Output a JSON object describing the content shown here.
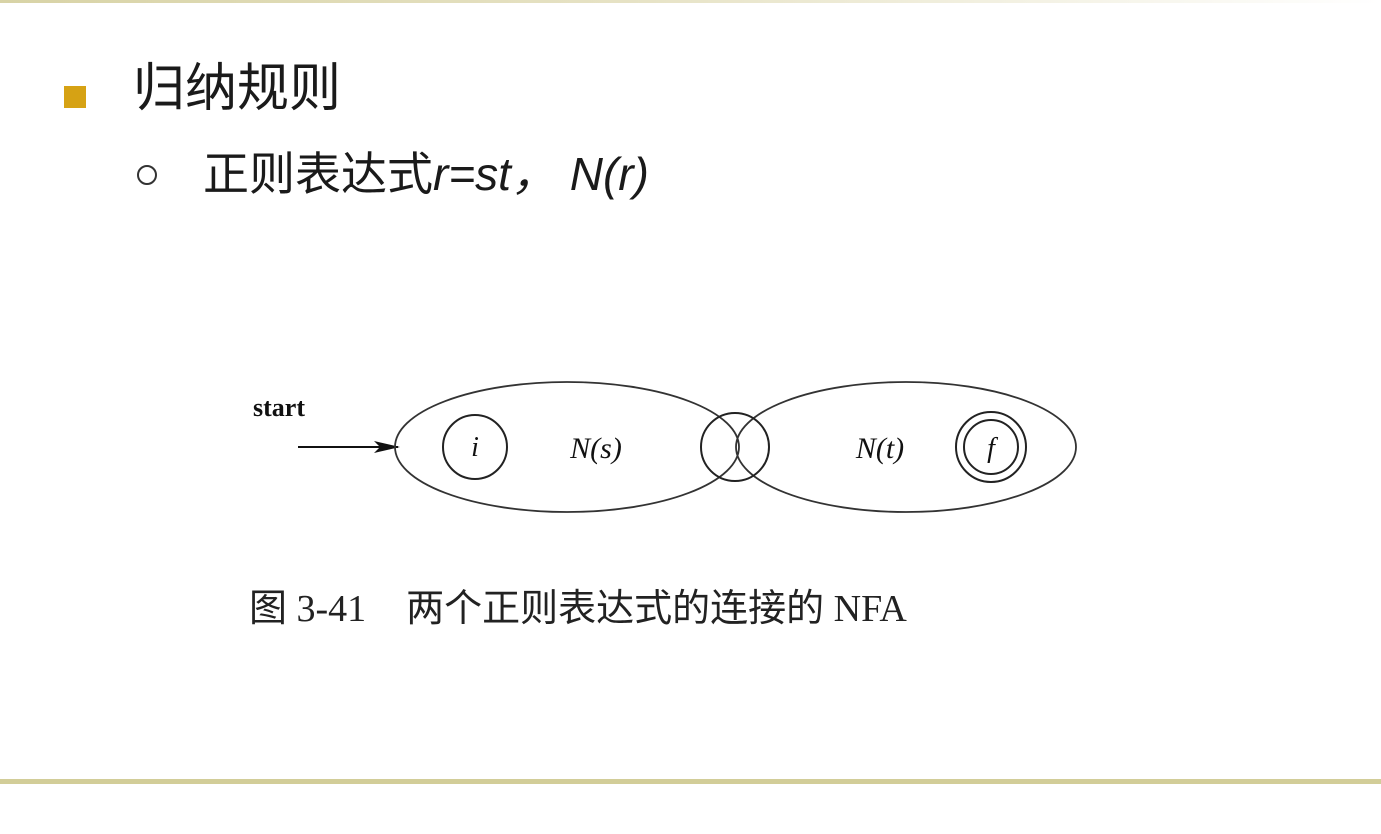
{
  "slide": {
    "heading": "归纳规则",
    "subline_prefix": "正则表达式",
    "subline_expr": "r=st， N(r)"
  },
  "diagram": {
    "start_label": "start",
    "state_i": "i",
    "state_f": "f",
    "label_ns": "N(s)",
    "label_nt": "N(t)"
  },
  "caption": {
    "number": "图 3-41",
    "text": "两个正则表达式的连接的 NFA"
  },
  "colors": {
    "bullet_square": "#d6a214",
    "rule": "#d2cd98"
  }
}
